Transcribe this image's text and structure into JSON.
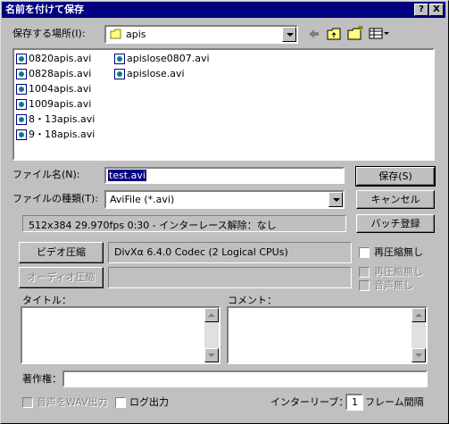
{
  "window": {
    "title": "名前を付けて保存",
    "help_btn": "?",
    "close_btn": "X"
  },
  "save_in": {
    "label": "保存する場所(I):",
    "value": "apis",
    "icon": "folder-icon"
  },
  "files": [
    "0820apis.avi",
    "0828apis.avi",
    "1004apis.avi",
    "1009apis.avi",
    "8・13apis.avi",
    "9・18apis.avi",
    "apislose0807.avi",
    "apislose.avi"
  ],
  "filename": {
    "label": "ファイル名(N):",
    "value": "test.avi"
  },
  "filetype": {
    "label": "ファイルの種類(T):",
    "value": "AviFile (*.avi)"
  },
  "buttons": {
    "save": "保存(S)",
    "cancel": "キャンセル",
    "batch": "バッチ登録"
  },
  "info": "512x384  29.970fps  0:30  -  インターレース解除：なし",
  "video": {
    "button": "ビデオ圧縮",
    "codec": "DivXα 6.4.0 Codec (2 Logical CPUs)",
    "no_recompress": "再圧縮無し"
  },
  "audio": {
    "button": "オーディオ圧縮",
    "codec": "",
    "no_recompress": "再圧縮無し",
    "no_audio": "音声無し"
  },
  "title_field": {
    "label": "タイトル："
  },
  "comment_field": {
    "label": "コメント："
  },
  "copyright": {
    "label": "著作権：",
    "value": ""
  },
  "bottom": {
    "wav_output": "音声をWAV出力",
    "log_output": "ログ出力",
    "interleave_label": "インターリーブ：",
    "interleave_value": "1",
    "interleave_unit": "フレーム間隔"
  }
}
